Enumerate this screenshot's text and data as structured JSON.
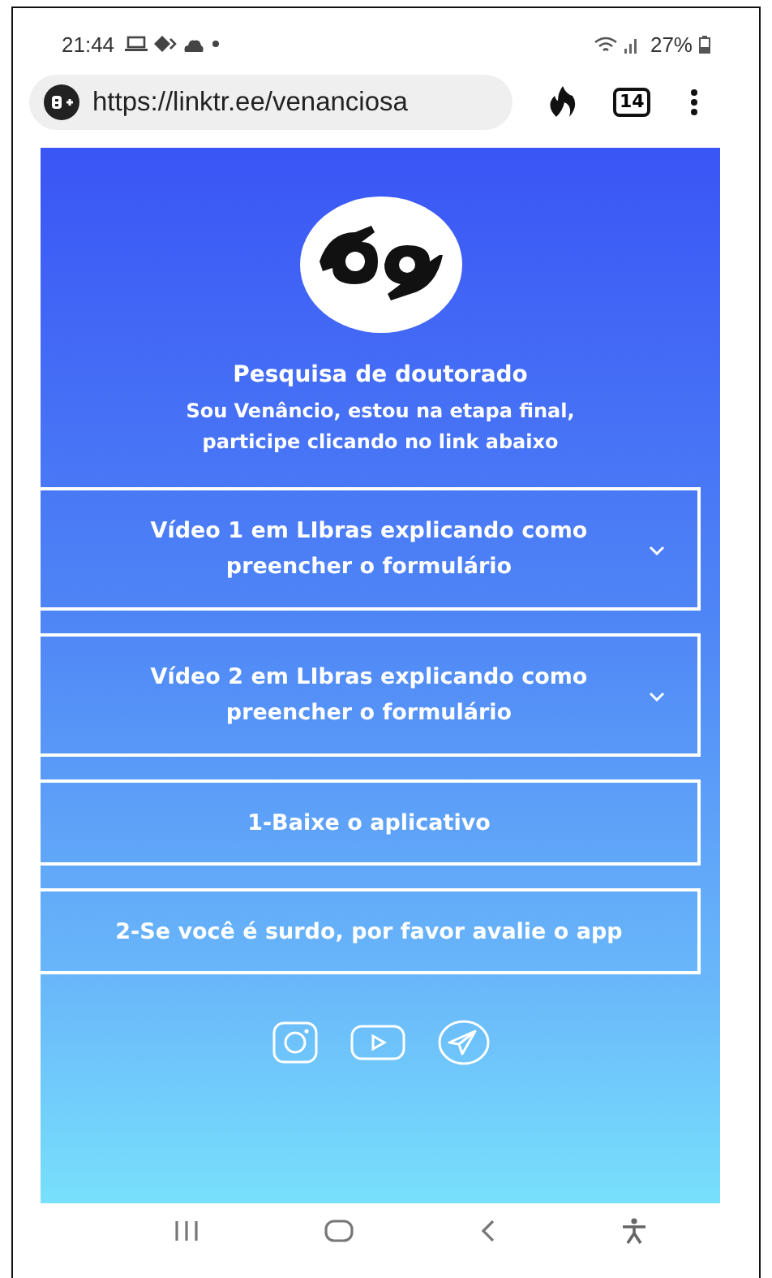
{
  "status_bar": {
    "time": "21:44",
    "battery": "27%"
  },
  "browser": {
    "url": "https://linktr.ee/venanciosa",
    "tab_count": "14"
  },
  "profile": {
    "title": "Pesquisa de doutorado",
    "bio": [
      "Sou Venâncio, estou na etapa final,",
      "participe clicando no link abaixo"
    ]
  },
  "links": [
    {
      "kind": "accordion",
      "label": "Vídeo 1 em LIbras explicando como preencher o formulário"
    },
    {
      "kind": "accordion",
      "label": "Vídeo 2 em LIbras explicando como preencher o formulário"
    },
    {
      "kind": "link",
      "label": "1-Baixe o aplicativo"
    },
    {
      "kind": "link",
      "label": "2-Se você é surdo, por favor avalie o app"
    }
  ]
}
